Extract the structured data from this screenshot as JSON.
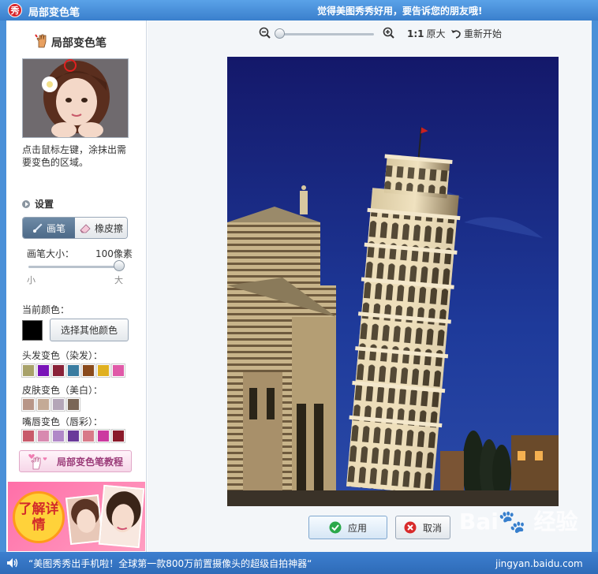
{
  "titlebar": {
    "app_icon_text": "秀",
    "title": "局部变色笔",
    "slogan": "觉得美图秀秀好用，要告诉您的朋友哦!"
  },
  "sidebar": {
    "panel_title": "局部变色笔",
    "hint": "点击鼠标左键，涂抹出需要变色的区域。",
    "settings_label": "设置",
    "tool_brush": "画笔",
    "tool_eraser": "橡皮擦",
    "brush_size_label": "画笔大小：",
    "brush_size_value": "100像素",
    "brush_size_fraction": 1.0,
    "small_label": "小",
    "big_label": "大",
    "current_color_label": "当前颜色：",
    "current_color": "#000000",
    "pick_color_button": "选择其他颜色",
    "hair_label": "头发变色（染发）：",
    "hair_colors": [
      "#a8a26a",
      "#7a14b8",
      "#8a2238",
      "#3a7ca0",
      "#8a4a1c",
      "#e0b020",
      "#e05aa8"
    ],
    "skin_label": "皮肤变色（美白）：",
    "skin_colors": [
      "#b89688",
      "#c4aa96",
      "#b4a6b8",
      "#7a6656"
    ],
    "lip_label": "嘴唇变色（唇彩）：",
    "lip_colors": [
      "#c85a6a",
      "#d88ab0",
      "#b088c8",
      "#6a3a9a",
      "#d87a88",
      "#cc3aa0",
      "#8a1a2a"
    ],
    "tutorial_button": "局部变色笔教程",
    "promo_badge": "了解详情"
  },
  "toolbar": {
    "zoom_fraction": 0.0,
    "actual_size_ratio": "1:1",
    "actual_size_label": "原大",
    "reset_label": "重新开始"
  },
  "actions": {
    "apply_label": "应用",
    "cancel_label": "取消"
  },
  "statusbar": {
    "text": "“美图秀秀出手机啦！全球第一款800万前置摄像头的超级自拍神器“"
  },
  "watermark": {
    "brand": "Bai🐾 经验",
    "url": "jingyan.baidu.com"
  },
  "colors": {
    "titlebar_blue": "#3a7fcc",
    "sky": "#1a237e",
    "accent_pink": "#ff6fa8"
  }
}
